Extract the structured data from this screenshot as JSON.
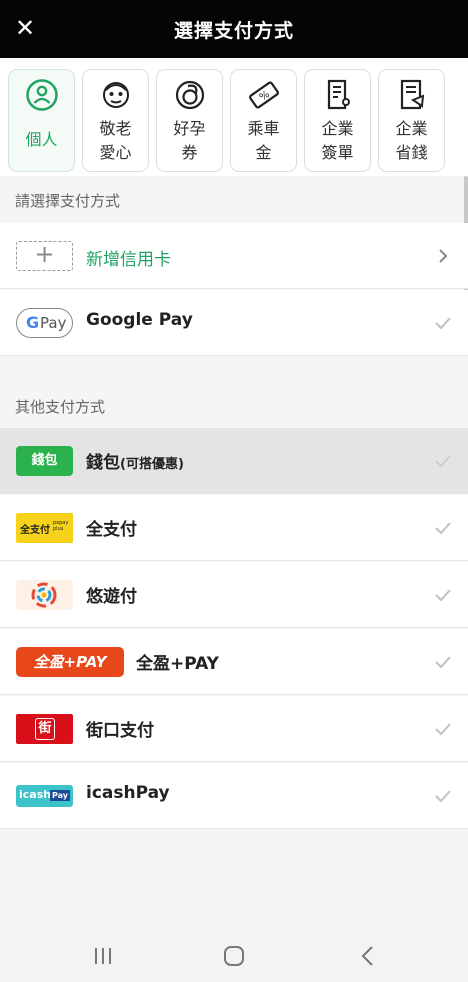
{
  "header": {
    "title": "選擇支付方式",
    "close_icon": "close-icon"
  },
  "categories": [
    {
      "label": "個人",
      "icon": "person-icon",
      "active": true
    },
    {
      "label": "敬老\n愛心",
      "icon": "elder-icon",
      "active": false
    },
    {
      "label": "好孕\n券",
      "icon": "pregnancy-icon",
      "active": false
    },
    {
      "label": "乘車\n金",
      "icon": "ticket-icon",
      "active": false
    },
    {
      "label": "企業\n簽單",
      "icon": "enterprise-sign-icon",
      "active": false
    },
    {
      "label": "企業\n省錢",
      "icon": "enterprise-save-icon",
      "active": false
    }
  ],
  "sections": {
    "primary": "請選擇支付方式",
    "other": "其他支付方式"
  },
  "add_card": {
    "plus": "+",
    "label": "新增信用卡"
  },
  "google_pay": {
    "logo_text": "Pay",
    "logo_g": "G",
    "label": "Google Pay"
  },
  "other_methods": [
    {
      "logo_text": "錢包",
      "label": "錢包",
      "note": "(可搭優惠)",
      "selected": true
    },
    {
      "logo_text": "全支付",
      "logo_sub": "pxpay plus",
      "label": "全支付",
      "selected": false
    },
    {
      "logo_text": "",
      "label": "悠遊付",
      "selected": false
    },
    {
      "logo_text": "全盈+PAY",
      "label": "全盈+PAY",
      "selected": false
    },
    {
      "logo_text": "街",
      "label": "街口支付",
      "selected": false
    },
    {
      "logo_text": "icash",
      "logo_sub": "Pay",
      "label": "icashPay",
      "selected": false
    }
  ],
  "colors": {
    "accent": "#1fa463",
    "topbar": "#050505",
    "check": "#c2c2c2"
  }
}
